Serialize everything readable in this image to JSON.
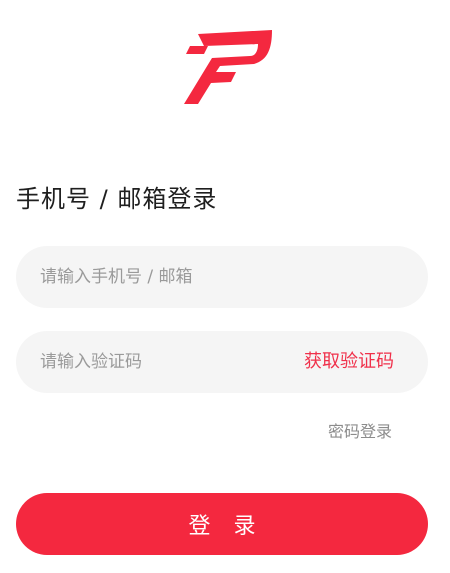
{
  "brand": {
    "logo_icon": "p-logo-icon",
    "accent_color": "#f4283f"
  },
  "header": {
    "title": "手机号 / 邮箱登录"
  },
  "form": {
    "phone_placeholder": "请输入手机号 / 邮箱",
    "phone_value": "",
    "code_placeholder": "请输入验证码",
    "code_value": "",
    "get_code_label": "获取验证码",
    "password_login_label": "密码登录",
    "submit_label": "登 录"
  }
}
